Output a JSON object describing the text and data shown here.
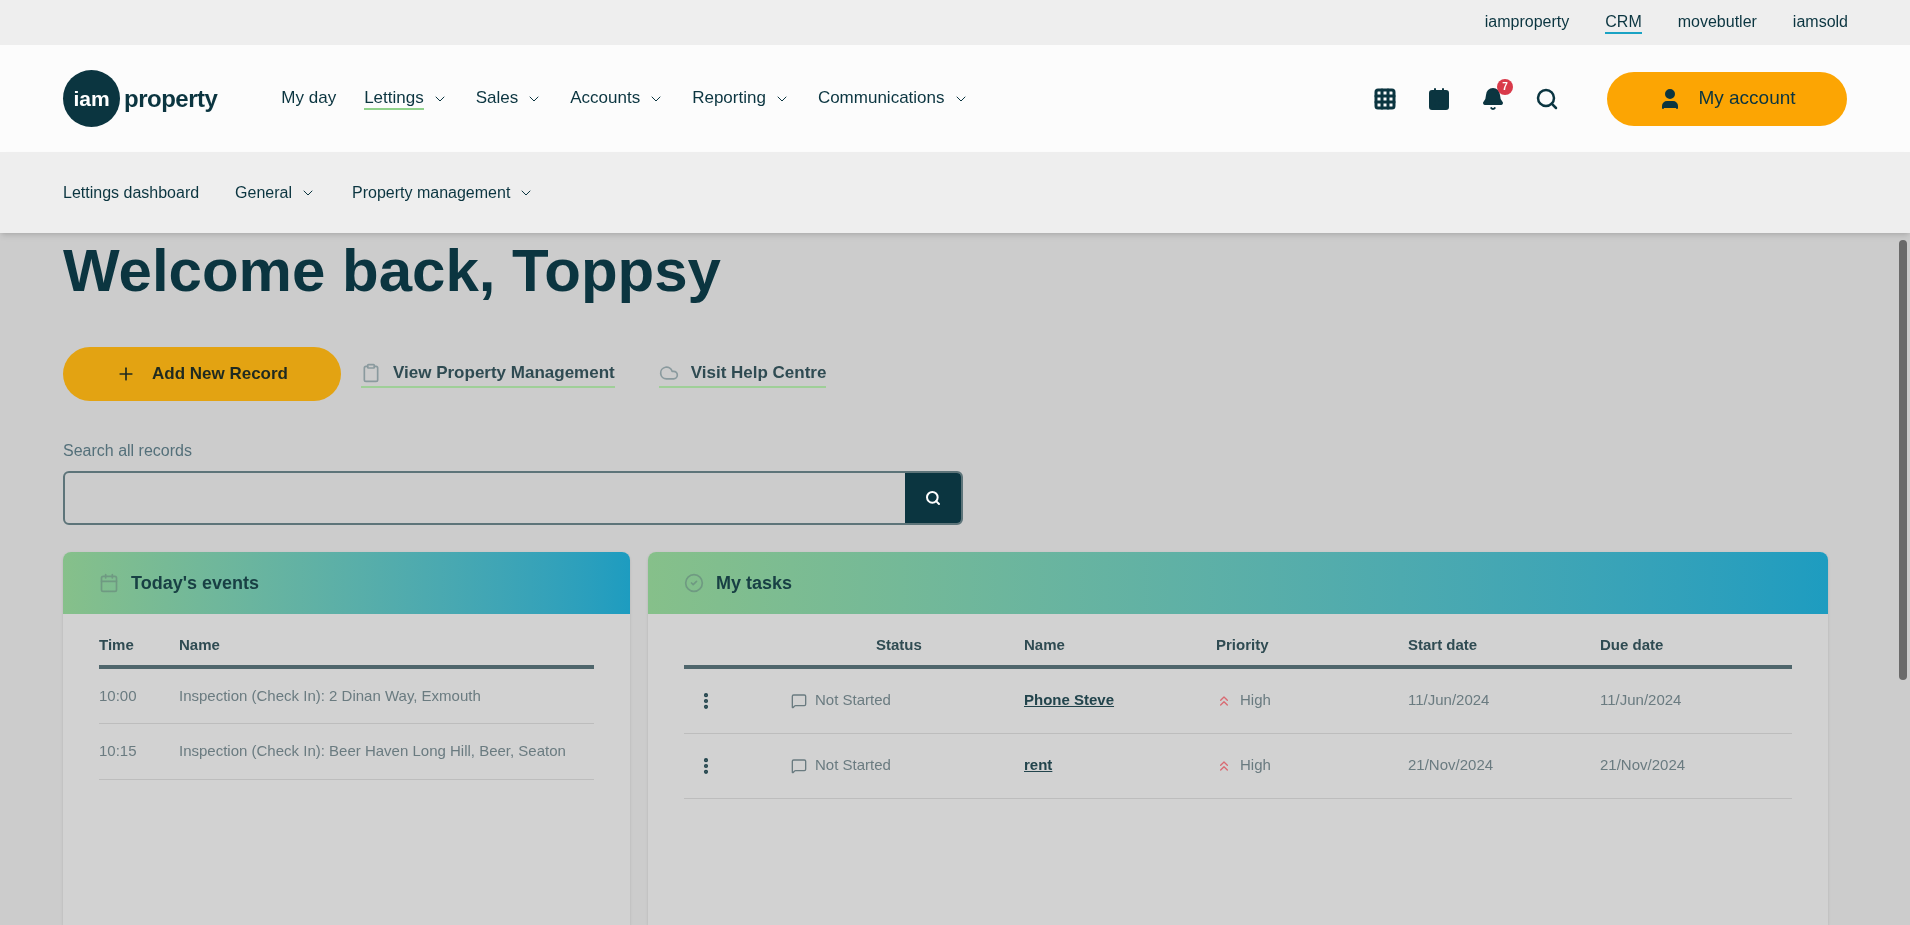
{
  "top_links": [
    {
      "label": "iamproperty",
      "selected": false
    },
    {
      "label": "CRM",
      "selected": true
    },
    {
      "label": "movebutler",
      "selected": false
    },
    {
      "label": "iamsold",
      "selected": false
    }
  ],
  "logo": {
    "circle_text": "iam",
    "text": "property"
  },
  "main_nav": [
    {
      "label": "My day",
      "dropdown": false,
      "selected": false
    },
    {
      "label": "Lettings",
      "dropdown": true,
      "selected": true
    },
    {
      "label": "Sales",
      "dropdown": true,
      "selected": false
    },
    {
      "label": "Accounts",
      "dropdown": true,
      "selected": false
    },
    {
      "label": "Reporting",
      "dropdown": true,
      "selected": false
    },
    {
      "label": "Communications",
      "dropdown": true,
      "selected": false
    }
  ],
  "notifications": {
    "count": "7"
  },
  "account_button": "My account",
  "sub_nav": [
    {
      "label": "Lettings dashboard",
      "dropdown": false
    },
    {
      "label": "General",
      "dropdown": true
    },
    {
      "label": "Property management",
      "dropdown": true
    }
  ],
  "heading": "Welcome back, Toppsy",
  "actions": [
    {
      "kind": "button",
      "label": "Add New Record"
    },
    {
      "kind": "link",
      "label": "View Property Management"
    },
    {
      "kind": "link",
      "label": "Visit Help Centre"
    }
  ],
  "search": {
    "label": "Search all records"
  },
  "events": {
    "title": "Today's events",
    "columns": [
      "Time",
      "Name"
    ],
    "rows": [
      {
        "time": "10:00",
        "name": "Inspection (Check In): 2 Dinan Way, Exmouth"
      },
      {
        "time": "10:15",
        "name": "Inspection (Check In): Beer Haven Long Hill, Beer, Seaton"
      }
    ]
  },
  "tasks": {
    "title": "My tasks",
    "columns": [
      "Status",
      "Name",
      "Priority",
      "Start date",
      "Due date"
    ],
    "rows": [
      {
        "status": "Not Started",
        "name": "Phone Steve",
        "priority": "High",
        "start": "11/Jun/2024",
        "due": "11/Jun/2024"
      },
      {
        "status": "Not Started",
        "name": "rent",
        "priority": "High",
        "start": "21/Nov/2024",
        "due": "21/Nov/2024"
      }
    ]
  }
}
